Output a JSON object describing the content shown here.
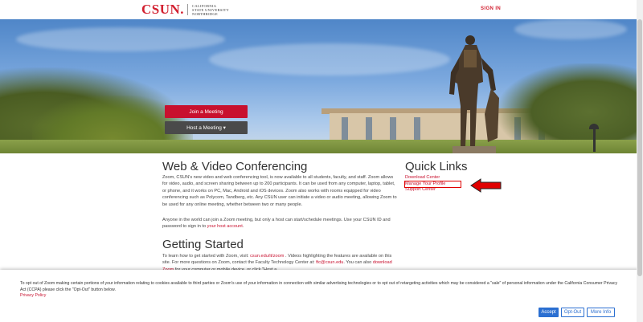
{
  "header": {
    "logo_mark": "CSUN.",
    "logo_sub_line1": "California",
    "logo_sub_line2": "State University",
    "logo_sub_line3": "Northridge",
    "sign_in": "SIGN IN"
  },
  "hero": {
    "join_label": "Join a Meeting",
    "host_label": "Host a Meeting ▾"
  },
  "main": {
    "title": "Web & Video Conferencing",
    "para1": "Zoom, CSUN's new video and web conferencing tool, is now available to all students, faculty, and staff. Zoom allows for video, audio, and screen sharing between up to 200 participants. It can be used from any computer, laptop, tablet, or phone, and it works on PC, Mac, Android and iOS devices. Zoom also works with rooms equipped for video conferencing such as Polycom, Tandberg, etc. Any CSUN user can initiate a video or audio meeting, allowing Zoom to be used for any online meeting, whether between two or many people.",
    "para2_text": "Anyone in the world can join a Zoom meeting, but only a host can start/schedule meetings. Use your CSUN ID and password to sign in to ",
    "para2_link": "your host account",
    "para2_end": ".",
    "getting_started_title": "Getting Started",
    "gs_text1": "To learn how to get started with Zoom, visit: ",
    "gs_link1": "csun.edu/it/zoom",
    "gs_text2": " . Videos highlighting the features are available on this site. For more questions on Zoom, contact the Faculty Technology Center at: ",
    "gs_link2": "ftc@csun.edu",
    "gs_text3": ". You can also ",
    "gs_link3": "download Zoom",
    "gs_text4": " for your computer or mobile device, or click \"Host a"
  },
  "quick_links": {
    "title": "Quick Links",
    "items": [
      "Download Center",
      "Manage Your Profile",
      "Support Center"
    ]
  },
  "cookie": {
    "text": "To opt out of Zoom making certain portions of your information relating to cookies available to third parties or Zoom's use of your information in connection with similar advertising technologies or to opt out of retargeting activities which may be considered a \"sale\" of personal information under the California Consumer Privacy Act (CCPA) please click the \"Opt-Out\" button below.",
    "privacy_label": "Privacy Policy",
    "accept_label": "Accept",
    "optout_label": "Opt-Out",
    "more_label": "More Info"
  },
  "colors": {
    "brand_red": "#c8102e",
    "host_gray": "#4a4a4a",
    "cookie_blue": "#2b6fd1",
    "annotation_red": "#e00000"
  }
}
